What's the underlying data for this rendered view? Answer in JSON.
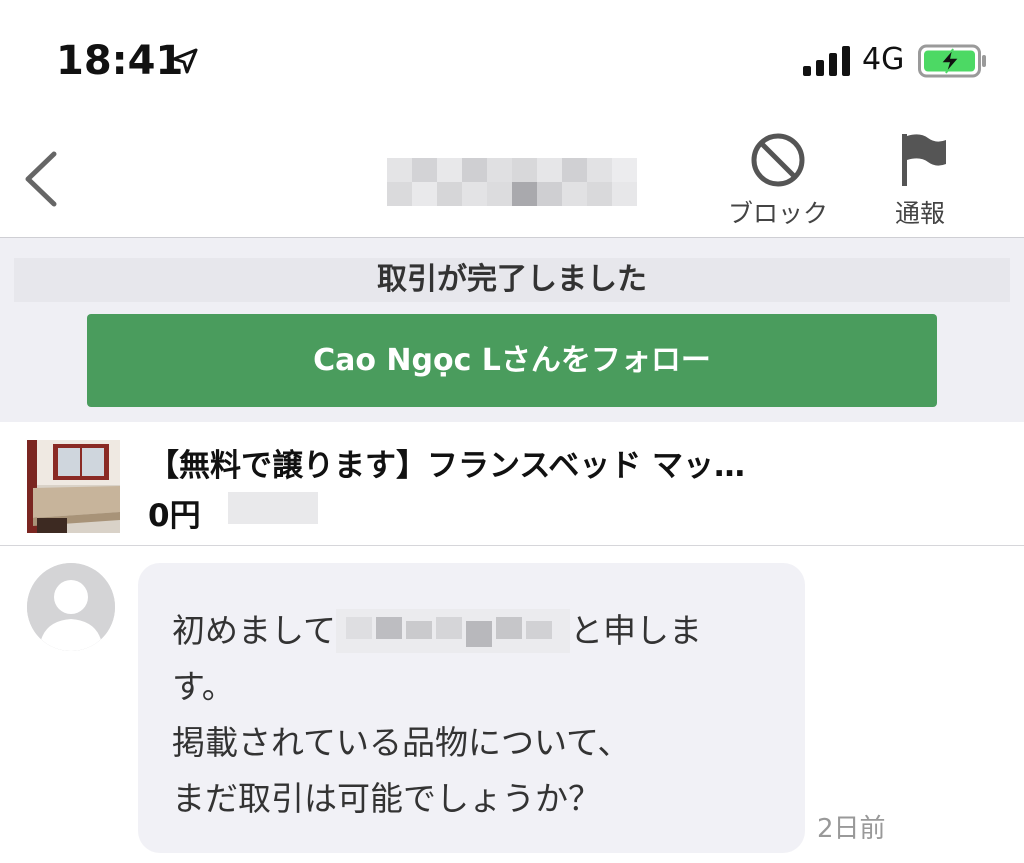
{
  "status_bar": {
    "time": "18:41",
    "network": "4G",
    "icons": [
      "location-arrow-icon",
      "cellular-signal-icon",
      "battery-charging-icon"
    ]
  },
  "nav": {
    "back_icon": "chevron-left-icon",
    "block_label": "ブロック",
    "block_icon": "prohibited-icon",
    "report_label": "通報",
    "report_icon": "flag-icon"
  },
  "banner": {
    "message": "取引が完了しました",
    "follow_button": "Cao Ngọc Lさんをフォロー"
  },
  "product": {
    "title": "【無料で譲ります】フランスベッド マッ…",
    "price": "0円"
  },
  "chat": {
    "message_lines": {
      "line1_before": "初めまして",
      "line1_after": "と申しま",
      "line2": "す。",
      "line3": "掲載されている品物について、",
      "line4": "まだ取引は可能でしょうか？"
    },
    "timestamp": "2日前"
  },
  "colors": {
    "follow_button": "#4a9c5d",
    "banner_bg": "#efeff4",
    "bubble_bg": "#f1f1f6",
    "battery_fill": "#4cd964"
  }
}
